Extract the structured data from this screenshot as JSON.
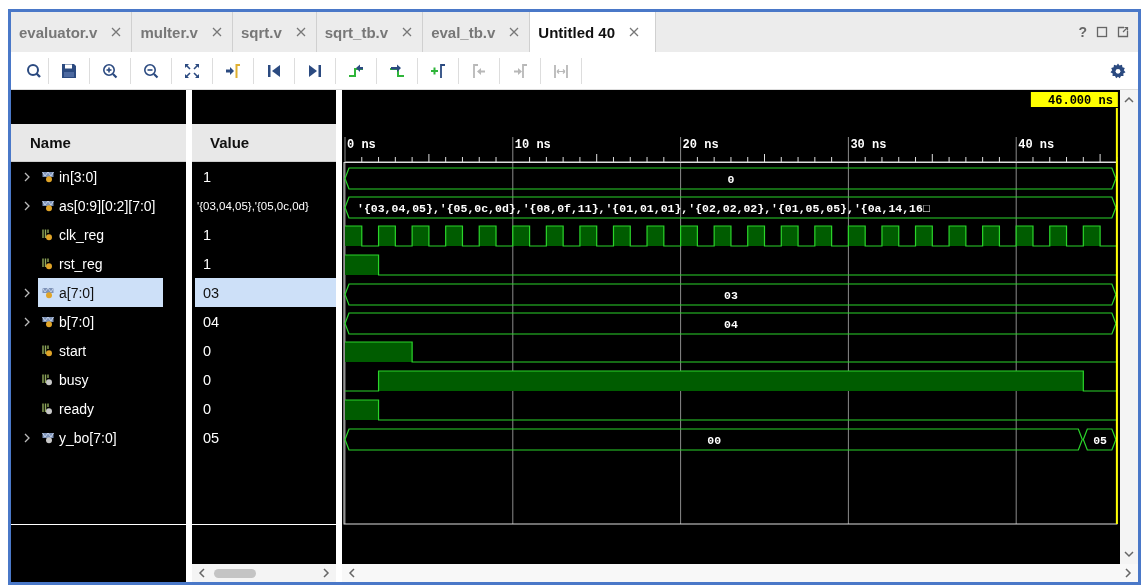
{
  "tabs": [
    {
      "label": "evaluator.v",
      "selected": false
    },
    {
      "label": "multer.v",
      "selected": false
    },
    {
      "label": "sqrt.v",
      "selected": false
    },
    {
      "label": "sqrt_tb.v",
      "selected": false
    },
    {
      "label": "eval_tb.v",
      "selected": false
    },
    {
      "label": "Untitled 40",
      "selected": true
    }
  ],
  "help": "?",
  "toolbar": [
    {
      "kind": "search",
      "disabled": false
    },
    {
      "kind": "save",
      "disabled": false
    },
    {
      "kind": "zoom-in",
      "disabled": false
    },
    {
      "kind": "zoom-out",
      "disabled": false
    },
    {
      "kind": "fit",
      "disabled": false
    },
    {
      "kind": "to-cursor",
      "disabled": false
    },
    {
      "kind": "first",
      "disabled": false
    },
    {
      "kind": "last",
      "disabled": false
    },
    {
      "kind": "prev-transition",
      "disabled": false
    },
    {
      "kind": "next-transition",
      "disabled": false
    },
    {
      "kind": "add-marker",
      "disabled": false
    },
    {
      "kind": "prev-marker",
      "disabled": true
    },
    {
      "kind": "next-marker",
      "disabled": true
    },
    {
      "kind": "swap",
      "disabled": true
    }
  ],
  "columns": [
    "Name",
    "Value"
  ],
  "signals": [
    {
      "name": "in[3:0]",
      "value": "1",
      "kind": "bus",
      "selected": false,
      "color": "#e0a428",
      "segments": [
        "0"
      ]
    },
    {
      "name": "as[0:9][0:2][7:0]",
      "value": "'{03,04,05},'{05,0c,0d}",
      "kind": "bus",
      "selected": false,
      "color": "#e0a428",
      "segments": [
        "'{03,04,05},'{05,0c,0d},'{08,0f,11},'{01,01,01},'{02,02,02},'{01,05,05},'{0a,14,16□"
      ]
    },
    {
      "name": "clk_reg",
      "value": "1",
      "kind": "bit",
      "selected": false,
      "color": "#e0a428"
    },
    {
      "name": "rst_reg",
      "value": "1",
      "kind": "bit",
      "selected": false,
      "color": "#e0a428"
    },
    {
      "name": "a[7:0]",
      "value": "03",
      "kind": "bus",
      "selected": true,
      "color": "#e0a428",
      "segments": [
        "03"
      ]
    },
    {
      "name": "b[7:0]",
      "value": "04",
      "kind": "bus",
      "selected": false,
      "color": "#e0a428",
      "segments": [
        "04"
      ]
    },
    {
      "name": "start",
      "value": "0",
      "kind": "bit",
      "selected": false,
      "color": "#e0a428"
    },
    {
      "name": "busy",
      "value": "0",
      "kind": "bit",
      "selected": false,
      "color": "#c8c8c8"
    },
    {
      "name": "ready",
      "value": "0",
      "kind": "bit",
      "selected": false,
      "color": "#c8c8c8"
    },
    {
      "name": "y_bo[7:0]",
      "value": "05",
      "kind": "bus",
      "selected": false,
      "color": "#c8c8c8",
      "segments": [
        "00",
        "05"
      ]
    }
  ],
  "ruler": {
    "labels": [
      "0 ns",
      "10 ns",
      "20 ns",
      "30 ns",
      "40 ns"
    ],
    "cursor": "46.000 ns"
  }
}
